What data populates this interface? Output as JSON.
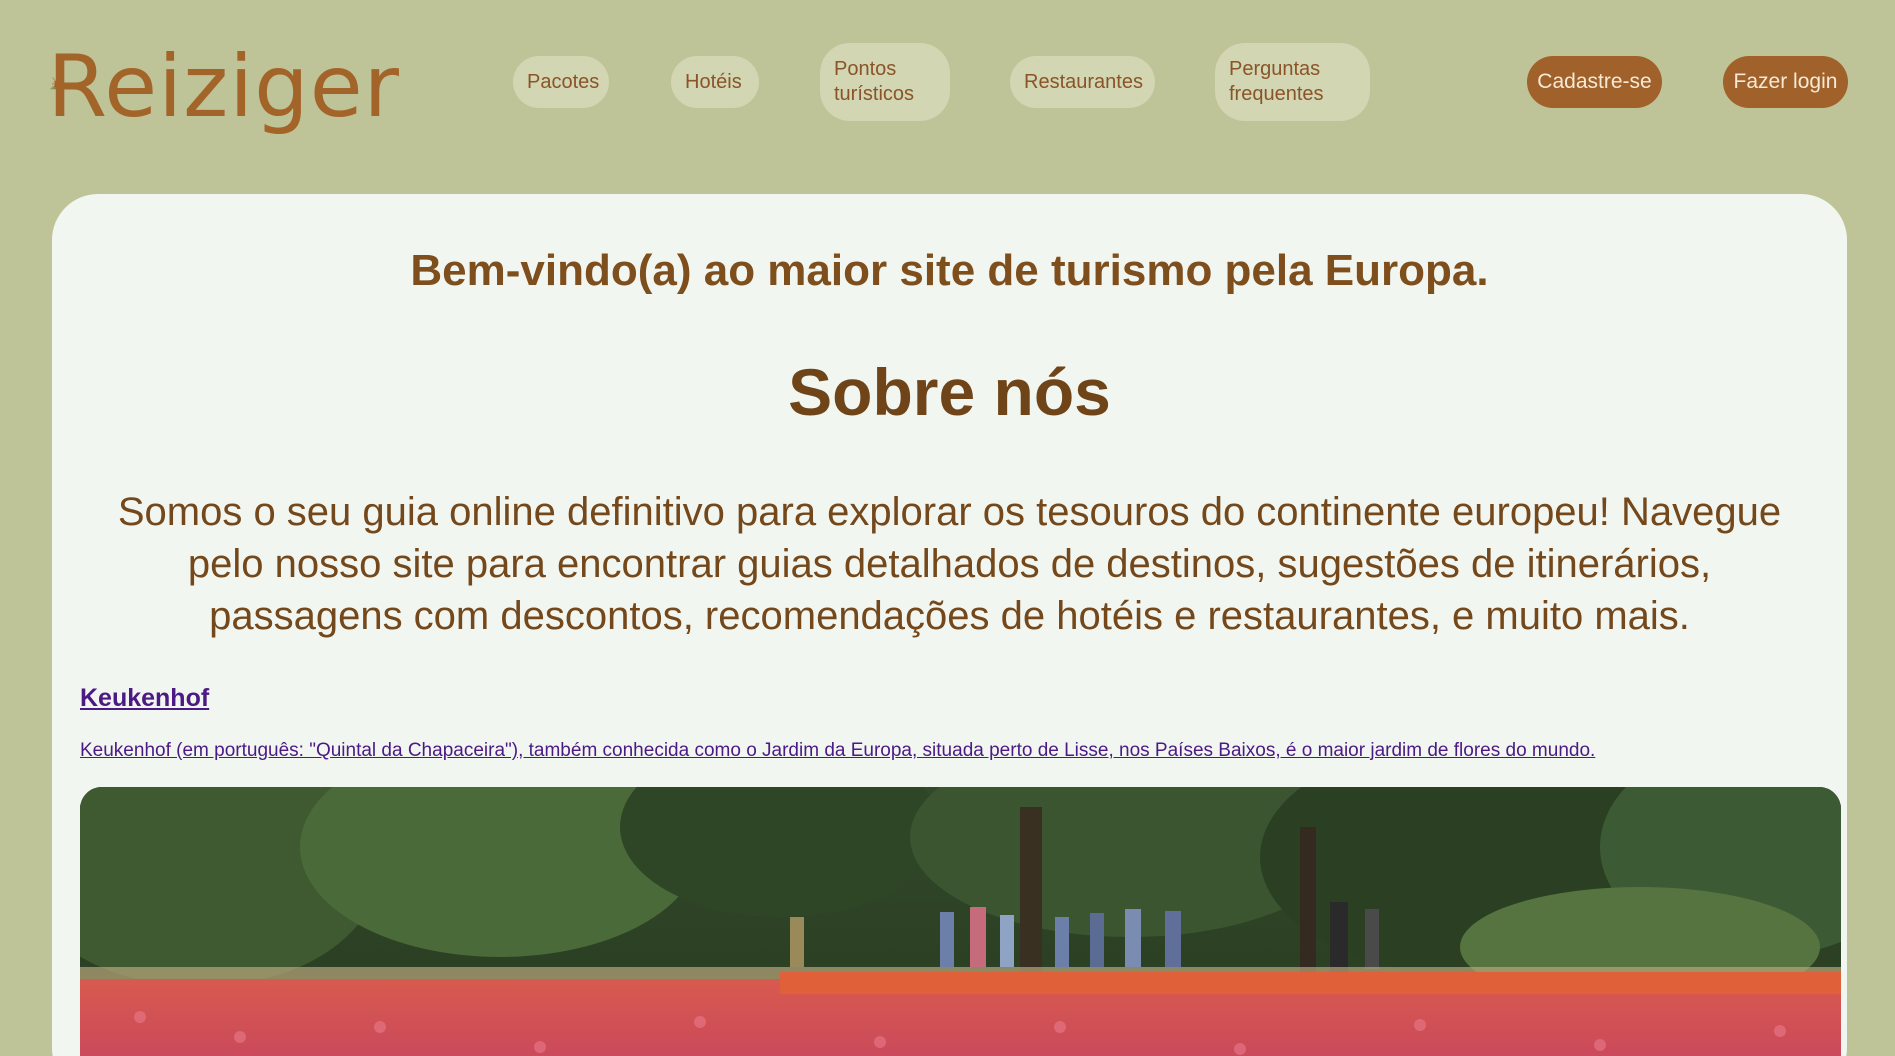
{
  "brand": {
    "name": "Reiziger",
    "logo_icon": "windmill-icon",
    "colors": {
      "brand_brown": "#a3642a",
      "background": "#bec497",
      "card": "#f1f6f1",
      "link": "#4b1a85"
    }
  },
  "nav": {
    "items": [
      {
        "label": "Pacotes"
      },
      {
        "label": "Hotéis"
      },
      {
        "label_line1": "Pontos",
        "label_line2": "turísticos"
      },
      {
        "label": "Restaurantes"
      },
      {
        "label_line1": "Perguntas",
        "label_line2": "frequentes"
      }
    ],
    "signup_label": "Cadastre-se",
    "login_label": "Fazer login"
  },
  "main": {
    "welcome": "Bem-vindo(a) ao maior site de turismo pela Europa.",
    "about_title": "Sobre nós",
    "about_text": "Somos o seu guia online definitivo para explorar os tesouros do continente europeu! Navegue pelo nosso site para encontrar guias detalhados de destinos, sugestões de itinerários, passagens com descontos, recomendações de hotéis e restaurantes, e muito mais.",
    "feature": {
      "title": "Keukenhof",
      "description": "Keukenhof (em português: \"Quintal da Chapaceira\"), também conhecida como o Jardim da Europa, situada perto de Lisse, nos Países Baixos, é o maior jardim de flores do mundo."
    }
  }
}
